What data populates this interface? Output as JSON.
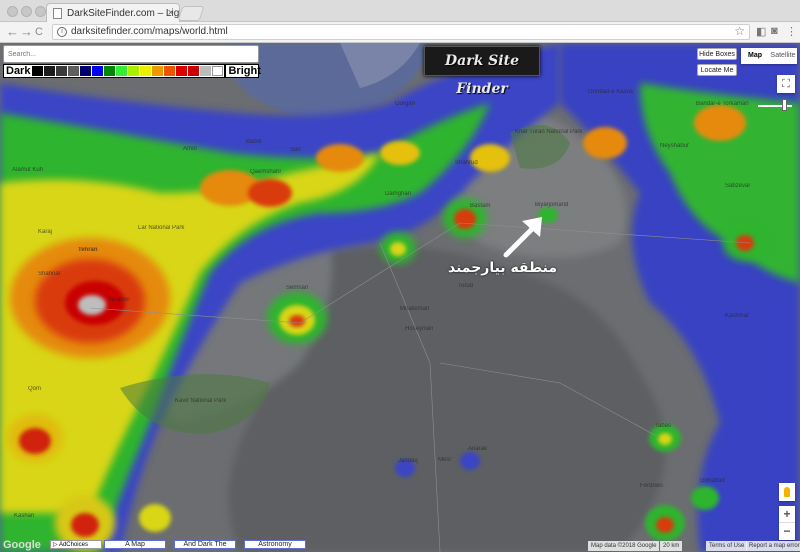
{
  "browser": {
    "tab_title": "DarkSiteFinder.com – Light Po",
    "tab_close": "×",
    "url": "darksitefinder.com/maps/world.html",
    "info_glyph": "i",
    "star_glyph": "☆",
    "back_glyph": "←",
    "forward_glyph": "→",
    "reload_glyph": "C"
  },
  "map_ui": {
    "search_placeholder": "Search...",
    "scale": {
      "dark_label": "Dark",
      "bright_label": "Bright",
      "colors": [
        "#000000",
        "#1c1c1c",
        "#3a3a3a",
        "#5e5e5e",
        "#00006e",
        "#0000ee",
        "#008800",
        "#33ee33",
        "#aaee00",
        "#eeee00",
        "#ee9900",
        "#ee5500",
        "#dd0000",
        "#cc0000",
        "#bbbbbb",
        "#ffffff"
      ]
    },
    "logo_text": "Dark Site Finder",
    "hide_boxes": "Hide Boxes",
    "locate_me": "Locate Me",
    "map_type": {
      "map": "Map",
      "satellite": "Satellite",
      "active": "Map"
    },
    "fullscreen_glyph": "⛶",
    "zoom_in": "+",
    "zoom_out": "−"
  },
  "annotation": {
    "text": "منطقه بیارجمند",
    "arrow_color": "#ffffff"
  },
  "places": [
    {
      "name": "Alamut Kuh"
    },
    {
      "name": "Karaj"
    },
    {
      "name": "Tehran"
    },
    {
      "name": "Shahriar"
    },
    {
      "name": "Varamin"
    },
    {
      "name": "Amol"
    },
    {
      "name": "Babol"
    },
    {
      "name": "Sari"
    },
    {
      "name": "Qaemshahr"
    },
    {
      "name": "Gorgan"
    },
    {
      "name": "Gonbad-e Kavus"
    },
    {
      "name": "Shahrud"
    },
    {
      "name": "Damghan"
    },
    {
      "name": "Semnan"
    },
    {
      "name": "Bastam"
    },
    {
      "name": "Biyarjomand"
    },
    {
      "name": "Kavir National Park"
    },
    {
      "name": "Lar National Park"
    },
    {
      "name": "Qom"
    },
    {
      "name": "Kashan"
    },
    {
      "name": "Jandaq"
    },
    {
      "name": "Mesr"
    },
    {
      "name": "Anarak"
    },
    {
      "name": "Tabas"
    },
    {
      "name": "Bandar-e Torkaman"
    },
    {
      "name": "Khar Turan National Park"
    },
    {
      "name": "Sabzevar"
    },
    {
      "name": "Neyshabur"
    },
    {
      "name": "Kashmar"
    },
    {
      "name": "Ferdows"
    },
    {
      "name": "Gonabad"
    },
    {
      "name": "Torud"
    },
    {
      "name": "Moalleman"
    },
    {
      "name": "Hoseynian"
    }
  ],
  "footer": {
    "google": "Google",
    "adchoices": "▷ AdChoices",
    "links": [
      "A Map",
      "And Dark The",
      "Astronomy"
    ],
    "map_data": "Map data ©2018 Google",
    "scale_text": "20 km",
    "terms": "Terms of Use",
    "report": "Report a map error"
  }
}
